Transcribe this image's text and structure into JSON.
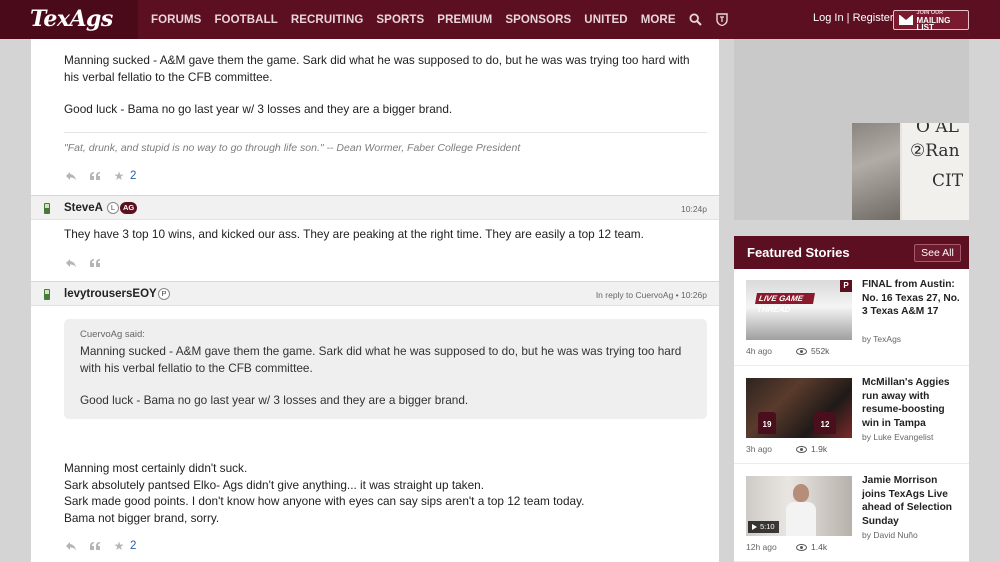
{
  "brand": {
    "logo_text": "TexAgs",
    "accent": "#5c0f21"
  },
  "nav": {
    "items": [
      "FORUMS",
      "FOOTBALL",
      "RECRUITING",
      "SPORTS",
      "PREMIUM",
      "SPONSORS",
      "UNITED",
      "MORE"
    ],
    "icons": [
      "search-icon",
      "shield-icon"
    ]
  },
  "auth": {
    "login": "Log In",
    "separator": "|",
    "register": "Register"
  },
  "mailing": {
    "small": "JOIN OUR",
    "big": "MAILING LIST"
  },
  "posts": [
    {
      "body_lines": [
        "Manning sucked - A&M gave them the game. Sark did what he was supposed to do, but he was was trying too hard with his verbal fellatio to the CFB committee.",
        "Good luck - Bama no go last year w/ 3 losses and they are a bigger brand."
      ],
      "signature": "\"Fat, drunk, and stupid is no way to go through life son.\" -- Dean Wormer, Faber College President",
      "star_count": "2"
    },
    {
      "user": "SteveA",
      "badges": [
        "L",
        "AG"
      ],
      "time": "10:24p",
      "body": "They have 3 top 10 wins, and kicked our ass. They are peaking at the right time. They are easily a top 12 team."
    },
    {
      "user": "levytrousersEOY",
      "badges": [
        "P"
      ],
      "time": "In reply to CuervoAg • 10:26p",
      "quote": {
        "who": "CuervoAg said:",
        "line1": "Manning sucked - A&M gave them the game. Sark did what he was supposed to do, but he was was trying too hard with his verbal fellatio to the CFB committee.",
        "line2": "Good luck - Bama no go last year w/ 3 losses and they are a bigger brand."
      },
      "body_lines": [
        "Manning most certainly didn't suck.",
        "Sark absolutely pantsed Elko- Ags didn't give anything... it was straight up taken.",
        "Sark made good points. I don't know how anyone with eyes can say sips aren't a top 12 team today.",
        "Bama not bigger brand, sorry."
      ],
      "star_count": "2"
    }
  ],
  "ad": {
    "words": [
      "O AL",
      "②Ran",
      "CIT"
    ]
  },
  "featured": {
    "title": "Featured Stories",
    "see_all": "See All",
    "stories": [
      {
        "title": "FINAL from Austin: No. 16 Texas 27, No. 3 Texas A&M 17",
        "author": "by TexAgs",
        "ago": "4h ago",
        "views": "552k",
        "thumb_banner": "LIVE GAME THREAD",
        "thumb_badge": "P"
      },
      {
        "title": "McMillan's Aggies run away with resume-boosting win in Tampa",
        "author": "by Luke Evangelist",
        "ago": "3h ago",
        "views": "1.9k",
        "jerseys": [
          "19",
          "12"
        ]
      },
      {
        "title": "Jamie Morrison joins TexAgs Live ahead of Selection Sunday",
        "author": "by David Nuño",
        "ago": "12h ago",
        "views": "1.4k",
        "video_length": "5:10"
      }
    ]
  }
}
